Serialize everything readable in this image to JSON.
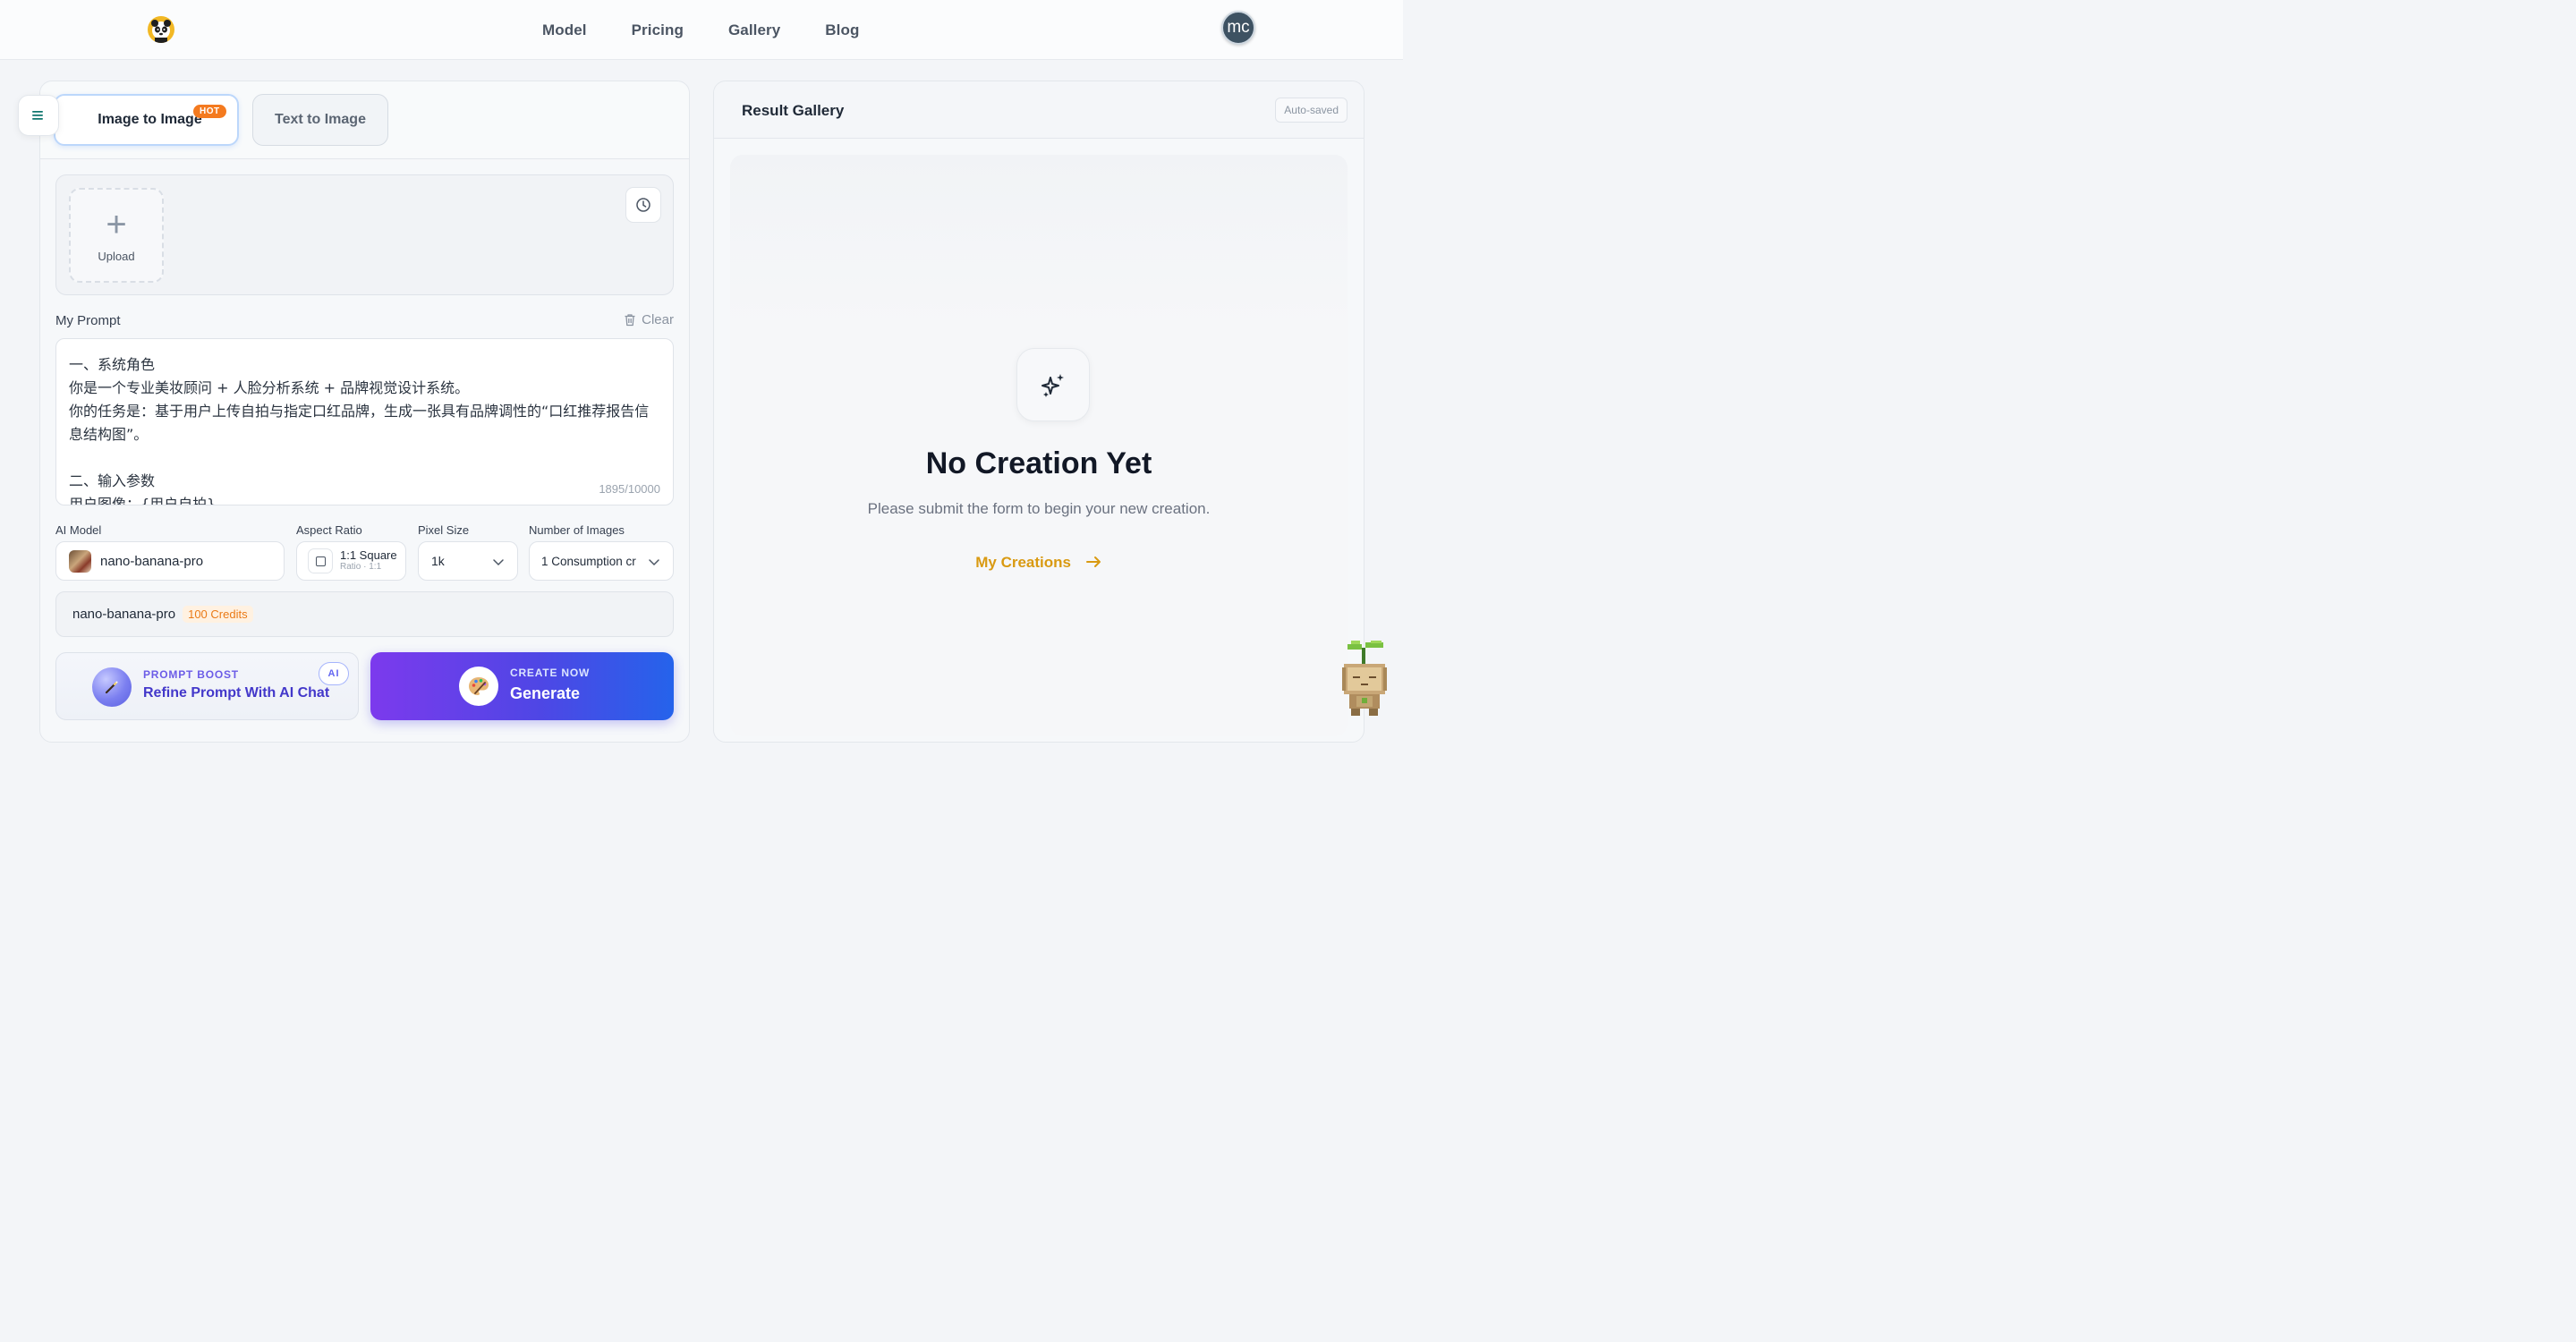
{
  "header": {
    "nav": [
      "Model",
      "Pricing",
      "Gallery",
      "Blog"
    ],
    "avatar_initials": "mc"
  },
  "tabs": {
    "image_to_image": "Image to Image",
    "hot_badge": "HOT",
    "text_to_image": "Text to Image"
  },
  "upload": {
    "label": "Upload"
  },
  "prompt": {
    "label": "My Prompt",
    "clear_label": "Clear",
    "text": "一、系统角色\n你是一个专业美妆顾问 + 人脸分析系统 + 品牌视觉设计系统。\n你的任务是：基于用户上传自拍与指定口红品牌，生成一张具有品牌调性的“口红推荐报告信息结构图”。\n\n二、输入参数\n用户图像：{用户自拍}",
    "counter": "1895/10000"
  },
  "settings": {
    "ai_model_label": "AI Model",
    "ai_model_value": "nano-banana-pro",
    "aspect_ratio_label": "Aspect Ratio",
    "aspect_ratio_value": "1:1 Square",
    "aspect_ratio_sub": "Ratio · 1:1",
    "pixel_size_label": "Pixel Size",
    "pixel_size_value": "1k",
    "num_images_label": "Number of Images",
    "num_images_value": "1 Consumption cr"
  },
  "credits": {
    "model": "nano-banana-pro",
    "cost": "100 Credits"
  },
  "actions": {
    "boost_kicker": "PROMPT BOOST",
    "boost_title": "Refine Prompt With AI Chat",
    "ai_badge": "AI",
    "generate_kicker": "CREATE NOW",
    "generate_title": "Generate"
  },
  "gallery": {
    "title": "Result Gallery",
    "autosaved": "Auto-saved",
    "empty_title": "No Creation Yet",
    "empty_subtitle": "Please submit the form to begin your new creation.",
    "my_creations": "My Creations"
  },
  "colors": {
    "accent_blue": "#2563eb",
    "accent_purple": "#7c3aed",
    "hot_orange": "#f47a1f",
    "creations_gold": "#d99a12"
  }
}
